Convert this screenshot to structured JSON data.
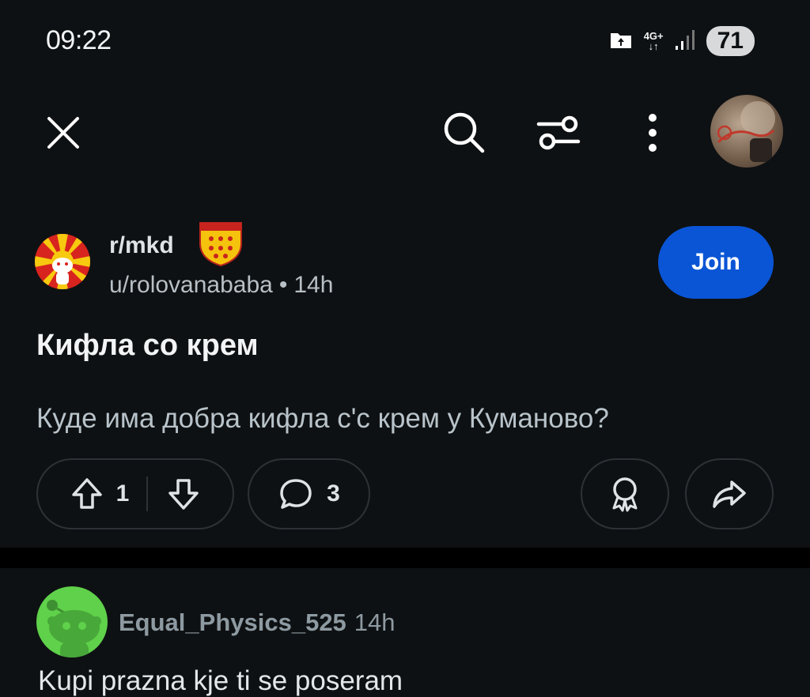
{
  "status_bar": {
    "time": "09:22",
    "network_type": "4G+",
    "battery_level": "71"
  },
  "toolbar": {
    "close_icon": "close-icon",
    "search_icon": "search-icon",
    "sort_icon": "sort-filter-icon",
    "more_icon": "more-vertical-icon"
  },
  "post": {
    "subreddit": "r/mkd",
    "author": "u/rolovanababa",
    "separator": "•",
    "age": "14h",
    "join_label": "Join",
    "title": "Кифла со крем",
    "body": "Куде има добра кифла с'с крем у Куманово?",
    "upvotes": "1",
    "comments": "3"
  },
  "comment": {
    "author": "Equal_Physics_525",
    "age": "14h",
    "text": "Kupi prazna kje ti se poseram"
  },
  "colors": {
    "background": "#0e1113",
    "join_button": "#0a55d6",
    "pill_border": "#2c3236",
    "comment_avatar": "#5fd14a"
  }
}
